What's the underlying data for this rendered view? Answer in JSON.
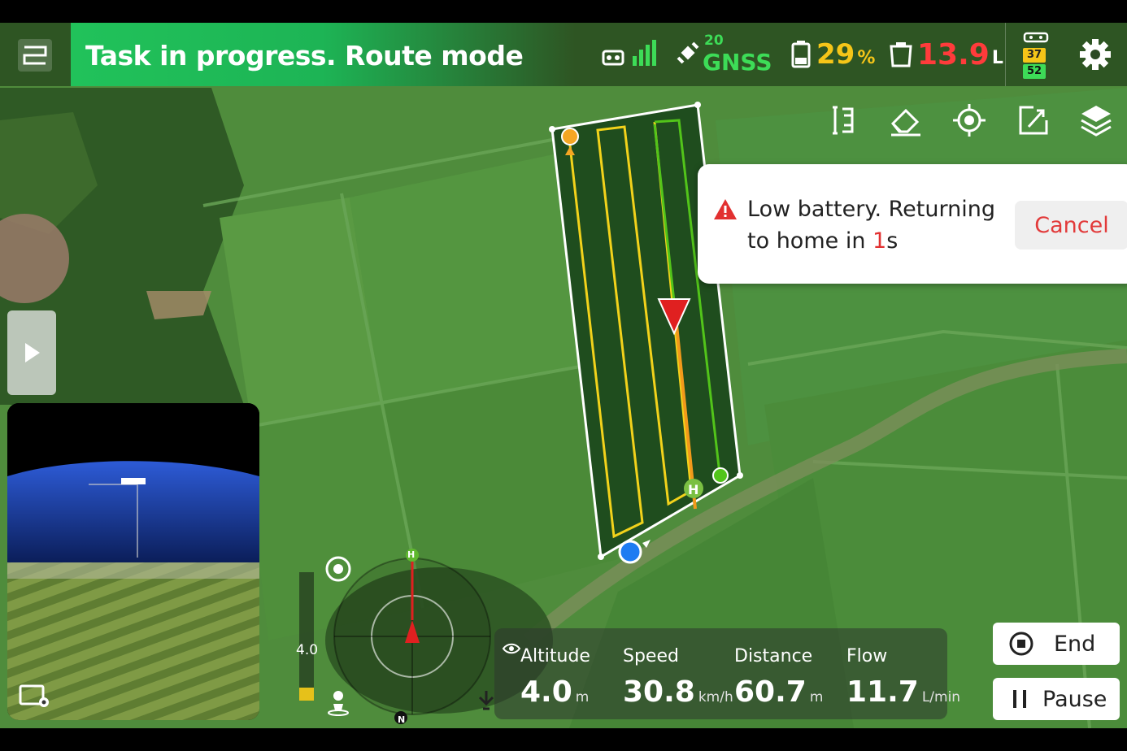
{
  "status": {
    "title": "Task in progress. Route mode"
  },
  "telemetry": {
    "gnss_count": "20",
    "gnss_label": "GNSS",
    "battery_value": "29",
    "battery_unit": "%",
    "tank_value": "13.9",
    "tank_unit": "L",
    "controller_top": "37",
    "controller_bottom": "52"
  },
  "toolbar": {
    "icons": [
      "route-bracket-icon",
      "eraser-icon",
      "locate-target-icon",
      "share-export-icon",
      "layers-icon",
      "gear-icon"
    ]
  },
  "toast": {
    "message_part1": "Low battery. Returning to home in ",
    "countdown": "1",
    "message_part2": "s",
    "cancel_label": "Cancel"
  },
  "altitude_bar": {
    "label": "4.0"
  },
  "compass": {
    "north_label": "N",
    "home_label": "H"
  },
  "stats": [
    {
      "label": "Altitude",
      "value": "4.0",
      "unit": "m"
    },
    {
      "label": "Speed",
      "value": "30.8",
      "unit": "km/h"
    },
    {
      "label": "Distance",
      "value": "60.7",
      "unit": "m"
    },
    {
      "label": "Flow",
      "value": "11.7",
      "unit": "L/min"
    }
  ],
  "actions": {
    "end_label": "End",
    "pause_label": "Pause"
  },
  "colors": {
    "banner_green": "#1db455",
    "warning_red": "#e23030",
    "battery_yellow": "#f5c518",
    "tank_red": "#ff3b3b",
    "route_yellow": "#f2d21b",
    "route_green": "#52c41a"
  }
}
